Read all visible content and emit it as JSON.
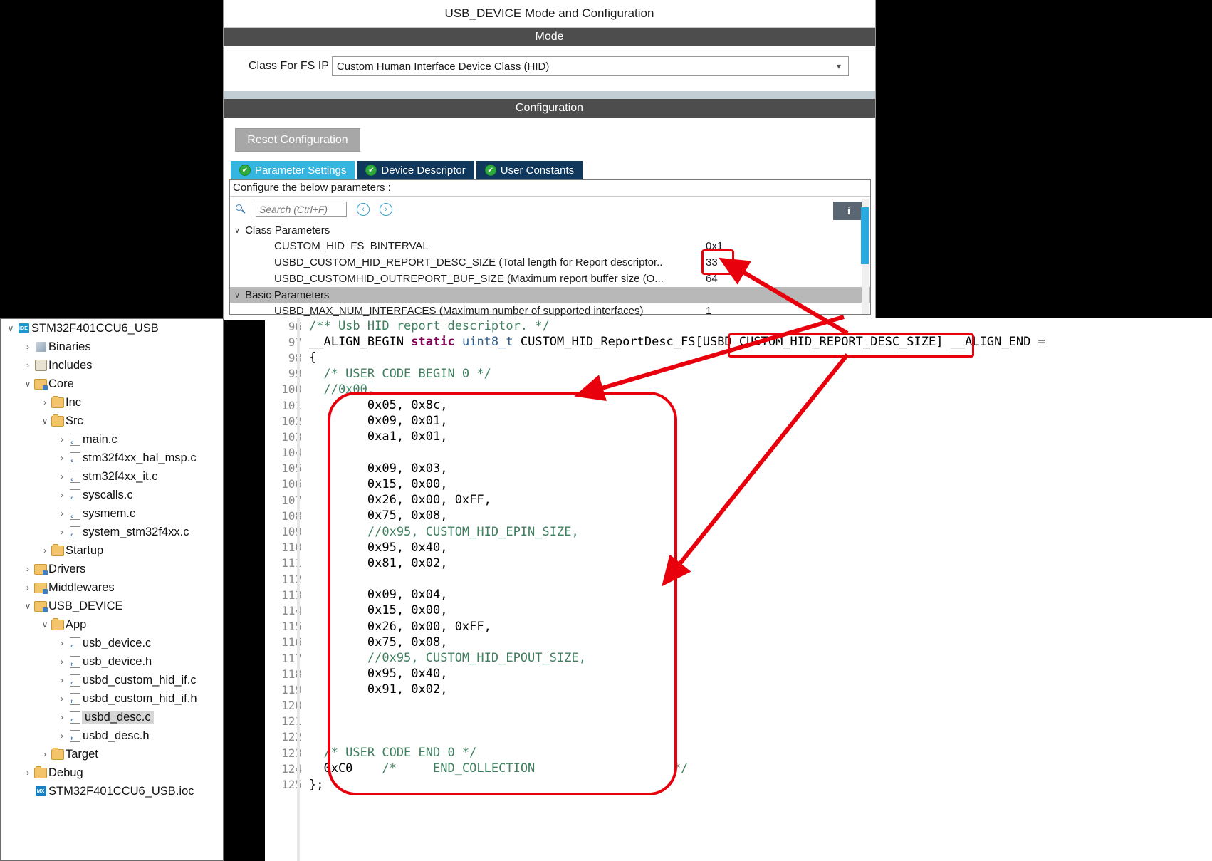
{
  "cubemx": {
    "title": "USB_DEVICE Mode and Configuration",
    "mode_section": "Mode",
    "class_label": "Class For FS IP",
    "class_value": "Custom Human Interface Device Class (HID)",
    "chevron": "⌄",
    "configuration_section": "Configuration",
    "reset_button": "Reset Configuration",
    "tabs": [
      {
        "label": "Parameter Settings",
        "active": true,
        "check": "✔"
      },
      {
        "label": "Device Descriptor",
        "active": false,
        "check": "✔"
      },
      {
        "label": "User Constants",
        "active": false,
        "check": "✔"
      }
    ],
    "configure_hint": "Configure the below parameters :",
    "search_placeholder": "Search (Ctrl+F)",
    "search_value": "",
    "nav_prev": "‹",
    "nav_next": "›",
    "info_icon": "i",
    "groups": [
      {
        "caret": "∨",
        "name": "Class Parameters"
      },
      {
        "caret": "∨",
        "name": "Basic Parameters"
      }
    ],
    "class_params": [
      {
        "name": "CUSTOM_HID_FS_BINTERVAL",
        "value": "0x1"
      },
      {
        "name": "USBD_CUSTOM_HID_REPORT_DESC_SIZE (Total length for Report descriptor..",
        "value": "33"
      },
      {
        "name": "USBD_CUSTOMHID_OUTREPORT_BUF_SIZE (Maximum report buffer size (O...",
        "value": "64"
      }
    ],
    "basic_params": [
      {
        "name": "USBD_MAX_NUM_INTERFACES (Maximum number of supported interfaces)",
        "value": "1"
      }
    ],
    "accent_color": "#34b6e0",
    "scrollbar_color": "#29abe2"
  },
  "explorer": {
    "items": [
      {
        "label": "STM32F401CCU6_USB",
        "indent": 0,
        "twisty": "∨",
        "icon": "ide-project-icon",
        "icon_text": "IDE",
        "selected": false
      },
      {
        "label": "Binaries",
        "indent": 1,
        "twisty": "›",
        "icon": "binaries-icon",
        "icon_text": "",
        "selected": false
      },
      {
        "label": "Includes",
        "indent": 1,
        "twisty": "›",
        "icon": "includes-icon",
        "icon_text": "",
        "selected": false
      },
      {
        "label": "Core",
        "indent": 1,
        "twisty": "∨",
        "icon": "source-folder-icon",
        "icon_text": "",
        "selected": false
      },
      {
        "label": "Inc",
        "indent": 2,
        "twisty": "›",
        "icon": "folder-icon",
        "icon_text": "",
        "selected": false
      },
      {
        "label": "Src",
        "indent": 2,
        "twisty": "∨",
        "icon": "folder-icon",
        "icon_text": "",
        "selected": false
      },
      {
        "label": "main.c",
        "indent": 3,
        "twisty": "›",
        "icon": "c-file-icon",
        "icon_text": "c",
        "selected": false
      },
      {
        "label": "stm32f4xx_hal_msp.c",
        "indent": 3,
        "twisty": "›",
        "icon": "c-file-icon",
        "icon_text": "c",
        "selected": false
      },
      {
        "label": "stm32f4xx_it.c",
        "indent": 3,
        "twisty": "›",
        "icon": "c-file-icon",
        "icon_text": "c",
        "selected": false
      },
      {
        "label": "syscalls.c",
        "indent": 3,
        "twisty": "›",
        "icon": "c-file-icon",
        "icon_text": "c",
        "selected": false
      },
      {
        "label": "sysmem.c",
        "indent": 3,
        "twisty": "›",
        "icon": "c-file-icon",
        "icon_text": "c",
        "selected": false
      },
      {
        "label": "system_stm32f4xx.c",
        "indent": 3,
        "twisty": "›",
        "icon": "c-file-icon",
        "icon_text": "c",
        "selected": false
      },
      {
        "label": "Startup",
        "indent": 2,
        "twisty": "›",
        "icon": "folder-icon",
        "icon_text": "",
        "selected": false
      },
      {
        "label": "Drivers",
        "indent": 1,
        "twisty": "›",
        "icon": "source-folder-icon",
        "icon_text": "",
        "selected": false
      },
      {
        "label": "Middlewares",
        "indent": 1,
        "twisty": "›",
        "icon": "source-folder-icon",
        "icon_text": "",
        "selected": false
      },
      {
        "label": "USB_DEVICE",
        "indent": 1,
        "twisty": "∨",
        "icon": "source-folder-icon",
        "icon_text": "",
        "selected": false
      },
      {
        "label": "App",
        "indent": 2,
        "twisty": "∨",
        "icon": "folder-icon",
        "icon_text": "",
        "selected": false
      },
      {
        "label": "usb_device.c",
        "indent": 3,
        "twisty": "›",
        "icon": "c-file-icon",
        "icon_text": "c",
        "selected": false
      },
      {
        "label": "usb_device.h",
        "indent": 3,
        "twisty": "›",
        "icon": "h-file-icon",
        "icon_text": "h",
        "selected": false
      },
      {
        "label": "usbd_custom_hid_if.c",
        "indent": 3,
        "twisty": "›",
        "icon": "c-file-icon",
        "icon_text": "c",
        "selected": false
      },
      {
        "label": "usbd_custom_hid_if.h",
        "indent": 3,
        "twisty": "›",
        "icon": "h-file-icon",
        "icon_text": "h",
        "selected": false
      },
      {
        "label": "usbd_desc.c",
        "indent": 3,
        "twisty": "›",
        "icon": "c-file-icon",
        "icon_text": "c",
        "selected": true
      },
      {
        "label": "usbd_desc.h",
        "indent": 3,
        "twisty": "›",
        "icon": "h-file-icon",
        "icon_text": "h",
        "selected": false
      },
      {
        "label": "Target",
        "indent": 2,
        "twisty": "›",
        "icon": "folder-icon",
        "icon_text": "",
        "selected": false
      },
      {
        "label": "Debug",
        "indent": 1,
        "twisty": "›",
        "icon": "folder-icon",
        "icon_text": "",
        "selected": false
      },
      {
        "label": "STM32F401CCU6_USB.ioc",
        "indent": 1,
        "twisty": "",
        "icon": "ioc-file-icon",
        "icon_text": "MX",
        "selected": false
      }
    ]
  },
  "editor": {
    "lines": [
      {
        "n": "96",
        "segs": [
          {
            "t": "/** Usb HID report descriptor. */",
            "c": "cm"
          }
        ]
      },
      {
        "n": "97",
        "segs": [
          {
            "t": "__ALIGN_BEGIN ",
            "c": "tx"
          },
          {
            "t": "static",
            "c": "kw"
          },
          {
            "t": " ",
            "c": "tx"
          },
          {
            "t": "uint8_t",
            "c": "tp"
          },
          {
            "t": " CUSTOM_HID_ReportDesc_FS[USBD_CUSTOM_HID_REPORT_DESC_SIZE] __ALIGN_END =",
            "c": "tx"
          }
        ]
      },
      {
        "n": "98",
        "segs": [
          {
            "t": "{",
            "c": "tx"
          }
        ]
      },
      {
        "n": "99",
        "segs": [
          {
            "t": "  /* USER CODE BEGIN 0 */",
            "c": "cm"
          }
        ]
      },
      {
        "n": "100",
        "segs": [
          {
            "t": "  //0x00,",
            "c": "cm"
          }
        ]
      },
      {
        "n": "101",
        "segs": [
          {
            "t": "        0x05, 0x8c,",
            "c": "tx"
          }
        ]
      },
      {
        "n": "102",
        "segs": [
          {
            "t": "        0x09, 0x01,",
            "c": "tx"
          }
        ]
      },
      {
        "n": "103",
        "segs": [
          {
            "t": "        0xa1, 0x01,",
            "c": "tx"
          }
        ]
      },
      {
        "n": "104",
        "segs": [
          {
            "t": "",
            "c": "tx"
          }
        ]
      },
      {
        "n": "105",
        "segs": [
          {
            "t": "        0x09, 0x03,",
            "c": "tx"
          }
        ]
      },
      {
        "n": "106",
        "segs": [
          {
            "t": "        0x15, 0x00,",
            "c": "tx"
          }
        ]
      },
      {
        "n": "107",
        "segs": [
          {
            "t": "        0x26, 0x00, 0xFF,",
            "c": "tx"
          }
        ]
      },
      {
        "n": "108",
        "segs": [
          {
            "t": "        0x75, 0x08,",
            "c": "tx"
          }
        ]
      },
      {
        "n": "109",
        "segs": [
          {
            "t": "        //0x95, CUSTOM_HID_EPIN_SIZE,",
            "c": "cm"
          }
        ]
      },
      {
        "n": "110",
        "segs": [
          {
            "t": "        0x95, 0x40,",
            "c": "tx"
          }
        ]
      },
      {
        "n": "111",
        "segs": [
          {
            "t": "        0x81, 0x02,",
            "c": "tx"
          }
        ]
      },
      {
        "n": "112",
        "segs": [
          {
            "t": "",
            "c": "tx"
          }
        ]
      },
      {
        "n": "113",
        "segs": [
          {
            "t": "        0x09, 0x04,",
            "c": "tx"
          }
        ]
      },
      {
        "n": "114",
        "segs": [
          {
            "t": "        0x15, 0x00,",
            "c": "tx"
          }
        ]
      },
      {
        "n": "115",
        "segs": [
          {
            "t": "        0x26, 0x00, 0xFF,",
            "c": "tx"
          }
        ]
      },
      {
        "n": "116",
        "segs": [
          {
            "t": "        0x75, 0x08,",
            "c": "tx"
          }
        ]
      },
      {
        "n": "117",
        "segs": [
          {
            "t": "        //0x95, CUSTOM_HID_EPOUT_SIZE,",
            "c": "cm"
          }
        ]
      },
      {
        "n": "118",
        "segs": [
          {
            "t": "        0x95, 0x40,",
            "c": "tx"
          }
        ]
      },
      {
        "n": "119",
        "segs": [
          {
            "t": "        0x91, 0x02,",
            "c": "tx"
          }
        ]
      },
      {
        "n": "120",
        "segs": [
          {
            "t": "",
            "c": "tx"
          }
        ]
      },
      {
        "n": "121",
        "segs": [
          {
            "t": "",
            "c": "tx"
          }
        ]
      },
      {
        "n": "122",
        "segs": [
          {
            "t": "",
            "c": "tx"
          }
        ]
      },
      {
        "n": "123",
        "segs": [
          {
            "t": "  /* USER CODE END 0 */",
            "c": "cm"
          }
        ]
      },
      {
        "n": "124",
        "segs": [
          {
            "t": "  0xC0",
            "c": "tx"
          },
          {
            "t": "    /*     END_COLLECTION                   */",
            "c": "cm"
          }
        ]
      },
      {
        "n": "125",
        "segs": [
          {
            "t": "};",
            "c": "tx"
          }
        ]
      }
    ]
  },
  "annotations": {
    "color": "#e8000d",
    "highlight_value": "33",
    "highlight_macro": "USBD_CUSTOM_HID_REPORT_DESC_SIZE",
    "note": "arrows linking the 33 parameter value to the array size macro and the report descriptor body"
  }
}
